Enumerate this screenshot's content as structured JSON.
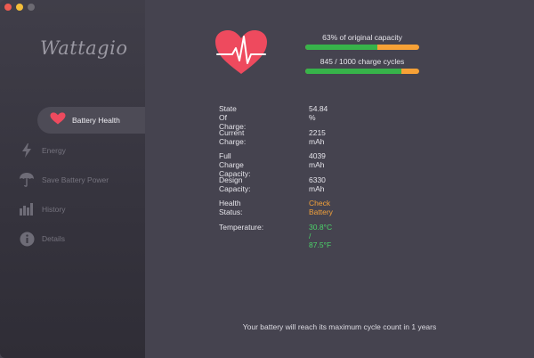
{
  "app": {
    "logo": "Wattagio"
  },
  "sidebar": {
    "items": [
      {
        "label": "Battery Health",
        "icon": "heart-icon",
        "active": true
      },
      {
        "label": "Energy",
        "icon": "lightning-icon"
      },
      {
        "label": "Save Battery Power",
        "icon": "umbrella-icon"
      },
      {
        "label": "History",
        "icon": "history-bars-icon"
      },
      {
        "label": "Details",
        "icon": "info-icon"
      }
    ]
  },
  "summary": {
    "capacity_text": "63% of original capacity",
    "capacity_percent": 63,
    "cycles_text": "845 / 1000 charge cycles",
    "cycles_fraction": 0.845
  },
  "details": [
    {
      "label": "State Of Charge:",
      "value": "54.84 %"
    },
    {
      "label": "Current Charge:",
      "value": "2215 mAh"
    },
    {
      "label": "Full Charge Capacity:",
      "value": "4039 mAh"
    },
    {
      "label": "Design Capacity:",
      "value": "6330 mAh"
    },
    {
      "label": "Health Status:",
      "value": "Check Battery"
    },
    {
      "label": "Temperature:",
      "value": "30.8°C / 87.5°F"
    }
  ],
  "footer": "Your battery will reach its maximum cycle count in 1 years",
  "colors": {
    "accent_red": "#ee4a5e",
    "bar_green": "#37b34a",
    "bar_orange": "#f7a136",
    "warn": "#f2a13b",
    "good": "#4cd36a"
  }
}
